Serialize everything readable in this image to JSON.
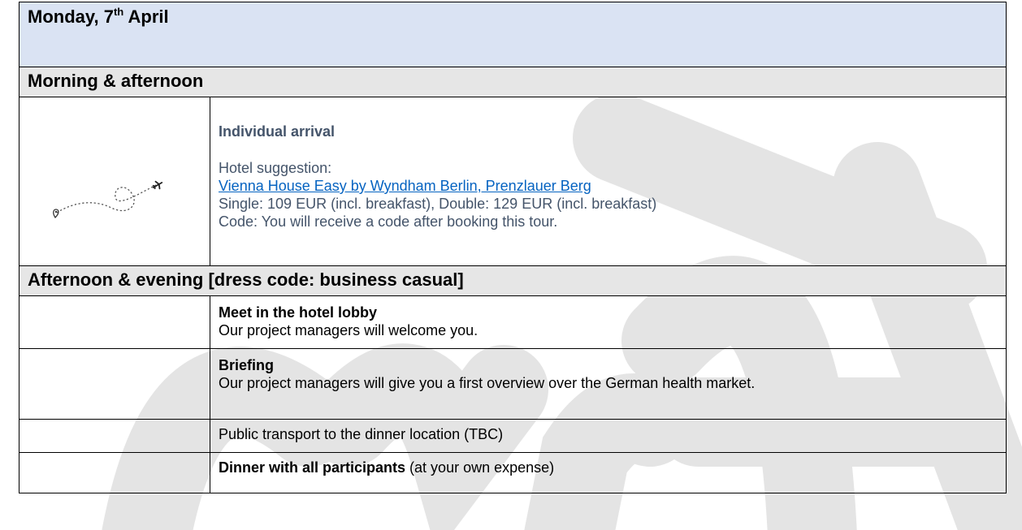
{
  "header": {
    "day_prefix": "Monday, 7",
    "day_suffix": "th",
    "day_month": " April"
  },
  "sections": {
    "morning": {
      "title": "Morning & afternoon",
      "icon": "travel-route-icon",
      "arrival_title": "Individual arrival",
      "hotel_suggestion_label": "Hotel suggestion:",
      "hotel_link_text": "Vienna House Easy by Wyndham Berlin, Prenzlauer Berg",
      "prices": "Single: 109 EUR (incl. breakfast), Double: 129 EUR (incl. breakfast)",
      "code_text": "Code: You will receive a code after booking this tour."
    },
    "afternoon": {
      "title": "Afternoon & evening [dress code: business casual]",
      "items": [
        {
          "title": "Meet in the hotel lobby",
          "description": "Our project managers will welcome you."
        },
        {
          "title": "Briefing",
          "description": "Our project managers will give you a first overview over the German health market."
        },
        {
          "title": "",
          "description": "Public transport to the dinner location (TBC)"
        },
        {
          "title": "Dinner with all participants",
          "description": " (at your own expense)"
        }
      ]
    }
  },
  "colors": {
    "day_header_bg": "#dae3f3",
    "section_header_bg": "#e6e6e6",
    "arrival_text": "#44546a",
    "link": "#0563c1",
    "watermark": "#d9d9d9"
  }
}
